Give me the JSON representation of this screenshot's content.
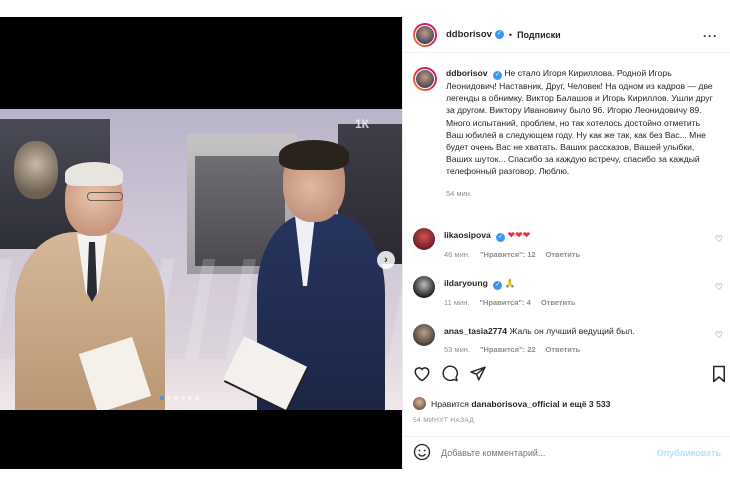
{
  "post": {
    "author": "ddborisov",
    "follow_label": "Подписки",
    "dot": "•",
    "more_icon": "more-horizontal-icon"
  },
  "caption": {
    "author": "ddborisov",
    "text": "Не стало Игоря Кириллова. Родной Игорь Леонидович! Наставник, Друг, Человек! На одном из кадров — две легенды в обнимку. Виктор Балашов и Игорь Кириллов. Ушли друг за другом. Виктору Ивановичу было 96. Игорю Леонидовичу 89. Много испытаний, проблем, но так хотелось достойно отметить Ваш юбилей в следующем году. Ну как же так, как без Вас... Мне будет очень Вас не хватать. Ваших рассказов, Вашей улыбки, Ваших шуток... Спасибо за каждую встречу, спасибо за каждый телефонный разговор. Люблю.",
    "time": "54 мин."
  },
  "media": {
    "channel_logo": "1К",
    "next_icon": "chevron-right-icon",
    "carousel_position": 1,
    "carousel_count": 6
  },
  "comments": [
    {
      "user": "likaosipova",
      "verified": true,
      "text": "❤❤❤",
      "time": "46 мин.",
      "likes": "\"Нравится\": 12",
      "reply": "Ответить"
    },
    {
      "user": "ildaryoung",
      "verified": true,
      "text": "🙏",
      "time": "11 мин.",
      "likes": "\"Нравится\": 4",
      "reply": "Ответить"
    },
    {
      "user": "anas_tasia2774",
      "verified": false,
      "text": "Жаль он лучший ведущий был.",
      "time": "53 мин.",
      "likes": "\"Нравится\": 22",
      "reply": "Ответить"
    }
  ],
  "likes": {
    "prefix": "Нравится",
    "user": "danaborisova_official",
    "suffix": "и ещё 3 533"
  },
  "posted_ago": "54 МИНУТ НАЗАД",
  "add_comment": {
    "placeholder": "Добавьте комментарий...",
    "publish_label": "Опубликовать"
  },
  "colors": {
    "link_blue": "#3897f0",
    "publish_disabled": "#b2dffc",
    "heart_red": "#ed2d41"
  }
}
